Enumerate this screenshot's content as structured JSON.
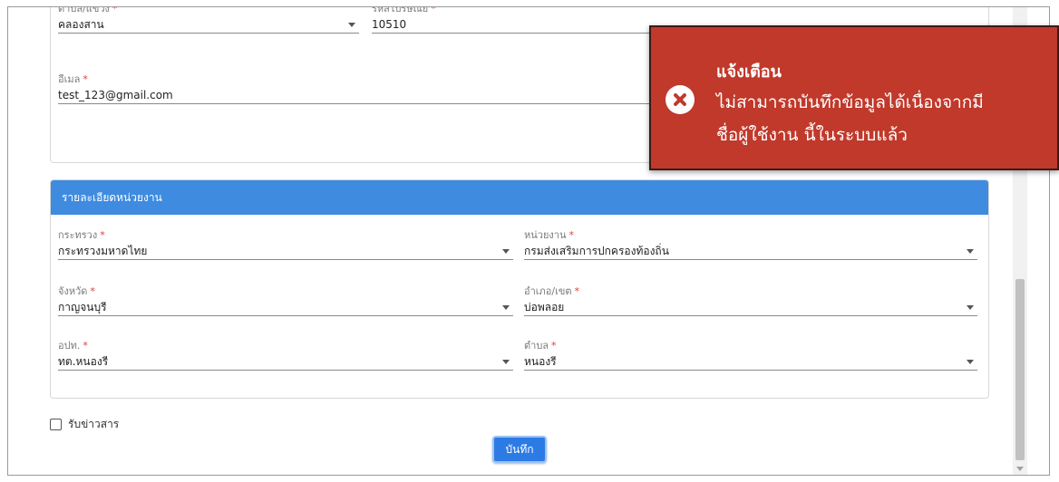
{
  "address": {
    "subdistrict": {
      "label": "ตำบล/แขวง",
      "required": "*",
      "value": "คลองสาน"
    },
    "postal_code": {
      "label": "รหัสไปรษณีย์",
      "required": "*",
      "value": "10510"
    },
    "email": {
      "label": "อีเมล",
      "required": "*",
      "value": "test_123@gmail.com"
    }
  },
  "org_section": {
    "title": "รายละเอียดหน่วยงาน",
    "ministry": {
      "label": "กระทรวง",
      "required": "*",
      "value": "กระทรวงมหาดไทย"
    },
    "agency": {
      "label": "หน่วยงาน",
      "required": "*",
      "value": "กรมส่งเสริมการปกครองท้องถิ่น"
    },
    "province": {
      "label": "จังหวัด",
      "required": "*",
      "value": "กาญจนบุรี"
    },
    "district": {
      "label": "อำเภอ/เขต",
      "required": "*",
      "value": "บ่อพลอย"
    },
    "local_admin": {
      "label": "อปท.",
      "required": "*",
      "value": "ทต.หนองรี"
    },
    "tambon": {
      "label": "ตำบล",
      "required": "*",
      "value": "หนองรี"
    }
  },
  "newsletter": {
    "label": "รับข่าวสาร",
    "checked": false
  },
  "actions": {
    "save_label": "บันทึก"
  },
  "toast": {
    "title": "แจ้งเตือน",
    "message_line1": "ไม่สามารถบันทึกข้อมูลได้เนื่องจากมี",
    "message_line2": "ชื่อผู้ใช้งาน นี้ในระบบแล้ว",
    "icon": "error-circle-x-icon",
    "background_color": "#c0392b"
  },
  "colors": {
    "accent": "#3f8be0",
    "required": "#e53935"
  }
}
